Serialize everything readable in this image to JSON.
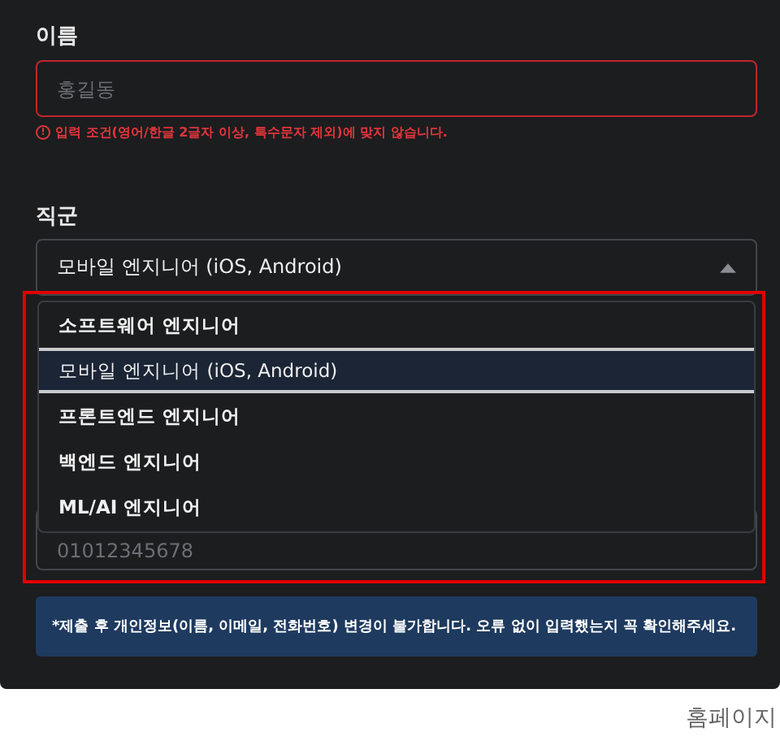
{
  "name_field": {
    "label": "이름",
    "placeholder": "홍길동",
    "error": "입력 조건(영어/한글 2글자 이상, 특수문자 제외)에 맞지 않습니다.",
    "error_icon": "!"
  },
  "job_field": {
    "label": "직군",
    "value": "모바일 엔지니어 (iOS, Android)",
    "expanded": true,
    "options": [
      {
        "label": "소프트웨어 엔지니어",
        "selected": false
      },
      {
        "label": "모바일 엔지니어 (iOS, Android)",
        "selected": true
      },
      {
        "label": "프론트엔드 엔지니어",
        "selected": false
      },
      {
        "label": "백엔드 엔지니어",
        "selected": false
      },
      {
        "label": "ML/AI 엔지니어",
        "selected": false
      }
    ]
  },
  "phone_field": {
    "placeholder": "01012345678"
  },
  "notice": "*제출 후 개인정보(이름, 이메일, 전화번호) 변경이 불가합니다. 오류 없이 입력했는지 꼭 확인해주세요.",
  "footer_link": "홈페이지"
}
